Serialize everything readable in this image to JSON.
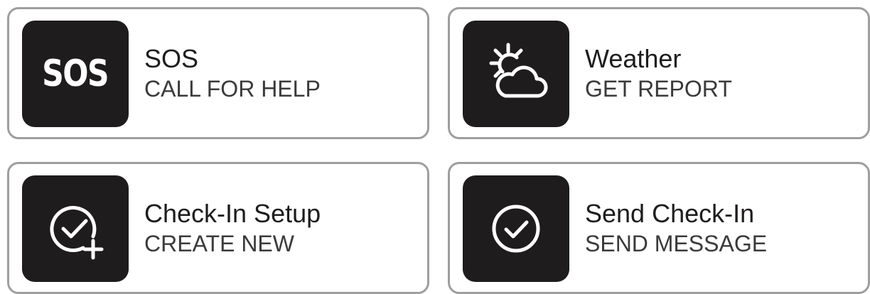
{
  "cards": [
    {
      "icon": "sos-icon",
      "icon_text": "SOS",
      "title": "SOS",
      "subtitle": "CALL FOR HELP"
    },
    {
      "icon": "weather-icon",
      "title": "Weather",
      "subtitle": "GET REPORT"
    },
    {
      "icon": "checkin-setup-icon",
      "title": "Check-In Setup",
      "subtitle": "CREATE NEW"
    },
    {
      "icon": "send-checkin-icon",
      "title": "Send Check-In",
      "subtitle": "SEND MESSAGE"
    }
  ],
  "colors": {
    "tile_bg": "#1e1c1d",
    "card_border": "#9e9e9e",
    "text": "#1e1c1d",
    "icon_fg": "#ffffff"
  }
}
